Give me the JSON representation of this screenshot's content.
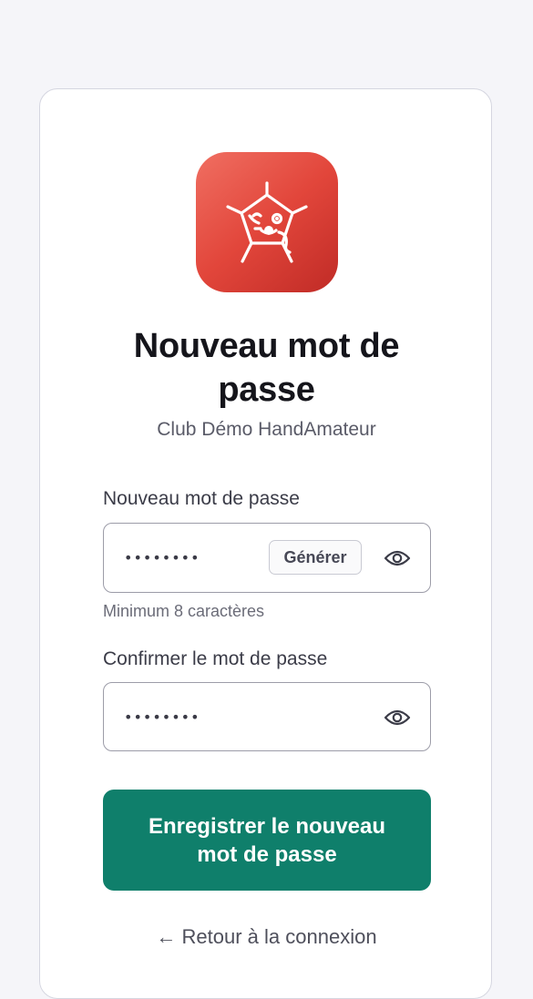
{
  "brand": {
    "accent": "#e2463b",
    "primary_button": "#0f7f6b",
    "logo_icon": "spider-web-mascot-icon"
  },
  "header": {
    "title": "Nouveau mot de passe",
    "subtitle": "Club Démo HandAmateur"
  },
  "form": {
    "new_password": {
      "label": "Nouveau mot de passe",
      "value": "••••••••",
      "generate_label": "Générer",
      "visibility_icon": "eye-icon",
      "hint": "Minimum 8 caractères"
    },
    "confirm_password": {
      "label": "Confirmer le mot de passe",
      "value": "••••••••",
      "visibility_icon": "eye-icon"
    },
    "submit_label": "Enregistrer le nouveau mot de passe",
    "back_link": "← Retour à la connexion"
  }
}
